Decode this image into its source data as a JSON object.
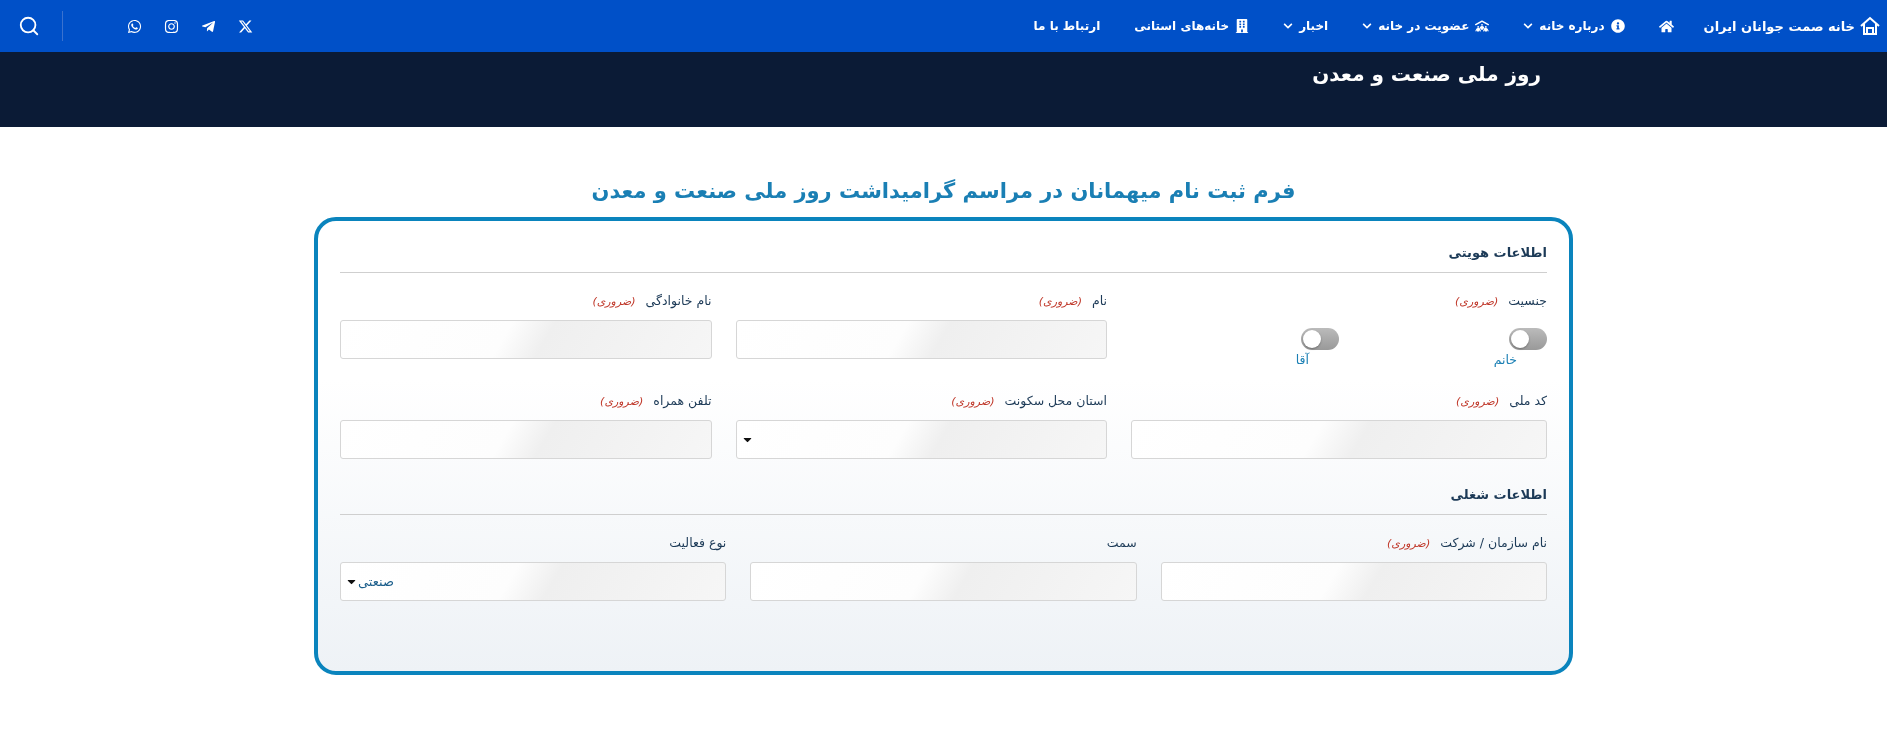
{
  "nav": {
    "brand": "خانه صمت جوانان ایران",
    "items": [
      {
        "label": "درباره خانه",
        "dropdown": true
      },
      {
        "label": "عضویت در خانه",
        "dropdown": true
      },
      {
        "label": "اخبار",
        "dropdown": true
      },
      {
        "label": "خانه‌های استانی",
        "dropdown": false
      },
      {
        "label": "ارتباط با ما",
        "dropdown": false
      }
    ]
  },
  "banner": {
    "title": "روز ملی صنعت و معدن"
  },
  "form": {
    "title": "فرم ثبت نام میهمانان در مراسم گرامیداشت روز ملی صنعت و معدن",
    "sections": [
      {
        "title": "اطلاعات هویتی",
        "fields": [
          {
            "kind": "toggles",
            "label": "جنسیت",
            "note": "(ضروری)",
            "options": [
              {
                "label": "خانم",
                "on": false
              },
              {
                "label": "آقا",
                "on": false
              }
            ]
          },
          {
            "kind": "text",
            "label": "نام",
            "note": "(ضروری)"
          },
          {
            "kind": "text",
            "label": "نام خانوادگی",
            "note": "(ضروری)"
          },
          {
            "kind": "text",
            "label": "کد ملی",
            "note": "(ضروری)"
          },
          {
            "kind": "select",
            "label": "استان محل سکونت",
            "note": "(ضروری)"
          },
          {
            "kind": "text",
            "label": "تلفن همراه",
            "note": "(ضروری)"
          }
        ]
      },
      {
        "title": "اطلاعات شغلی",
        "fields": [
          {
            "kind": "text",
            "label": "نام سازمان / شرکت",
            "note": "(ضروری)"
          },
          {
            "kind": "text",
            "label": "سمت"
          },
          {
            "kind": "select",
            "label": "نوع فعالیت",
            "value": "صنعتی"
          }
        ]
      }
    ]
  }
}
